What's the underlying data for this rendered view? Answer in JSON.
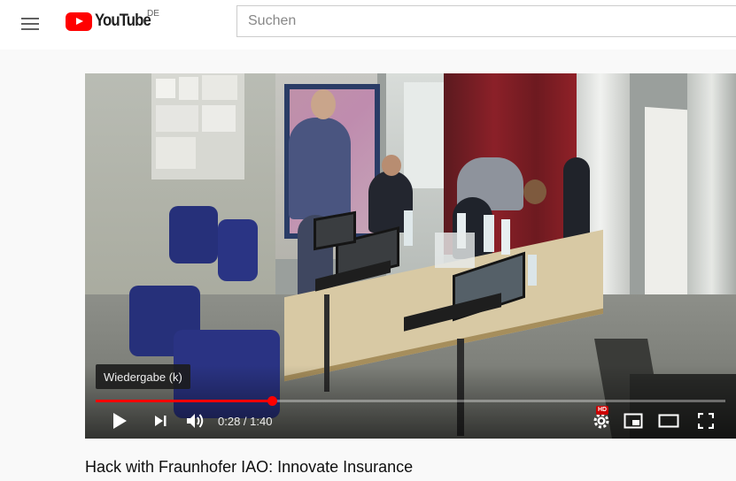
{
  "header": {
    "menu_icon": "hamburger-menu-icon",
    "logo_text": "YouTube",
    "logo_country": "DE",
    "search_placeholder": "Suchen"
  },
  "player": {
    "tooltip": "Wiedergabe (k)",
    "current_time": "0:28",
    "separator": " / ",
    "duration": "1:40",
    "progress_fraction": 0.28,
    "hd_badge": "HD",
    "icons": {
      "play": "play-icon",
      "next": "next-icon",
      "volume": "volume-icon",
      "settings": "settings-gear-icon",
      "miniplayer": "miniplayer-icon",
      "theater": "theater-mode-icon",
      "fullscreen": "fullscreen-icon"
    },
    "colors": {
      "progress": "#ff0000",
      "logo": "#ff0000"
    }
  },
  "video": {
    "title": "Hack with Fraunhofer IAO: Innovate Insurance"
  }
}
